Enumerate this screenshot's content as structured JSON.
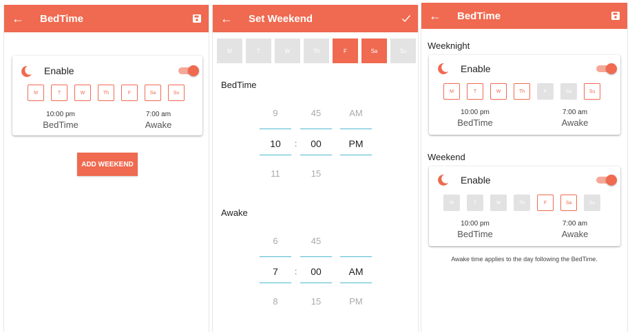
{
  "colors": {
    "accent": "#ef6a50",
    "toggle_track": "#f5a898",
    "picker_line": "#4cb8d0",
    "inactive": "#e2e2e2"
  },
  "screen1": {
    "title": "BedTime",
    "card": {
      "enable_label": "Enable",
      "days": [
        "M",
        "T",
        "W",
        "Th",
        "F",
        "Sa",
        "Su"
      ],
      "bedtime_time": "10:00 pm",
      "bedtime_label": "BedTime",
      "awake_time": "7:00 am",
      "awake_label": "Awake"
    },
    "add_weekend_label": "ADD WEEKEND"
  },
  "screen2": {
    "title": "Set Weekend",
    "days": [
      {
        "label": "M",
        "selected": false
      },
      {
        "label": "T",
        "selected": false
      },
      {
        "label": "W",
        "selected": false
      },
      {
        "label": "Th",
        "selected": false
      },
      {
        "label": "F",
        "selected": true
      },
      {
        "label": "Sa",
        "selected": true
      },
      {
        "label": "Su",
        "selected": false
      }
    ],
    "bedtime_label": "BedTime",
    "bedtime_picker": {
      "hours": [
        "9",
        "10",
        "11"
      ],
      "minutes": [
        "45",
        "00",
        "15"
      ],
      "ampm": [
        "AM",
        "PM",
        ""
      ]
    },
    "awake_label": "Awake",
    "awake_picker": {
      "hours": [
        "6",
        "7",
        "8"
      ],
      "minutes": [
        "45",
        "00",
        "15"
      ],
      "ampm": [
        "",
        "AM",
        "PM"
      ]
    },
    "separator": ":"
  },
  "screen3": {
    "title": "BedTime",
    "weeknight": {
      "section_label": "Weeknight",
      "enable_label": "Enable",
      "days": [
        {
          "label": "M",
          "on": true
        },
        {
          "label": "T",
          "on": true
        },
        {
          "label": "W",
          "on": true
        },
        {
          "label": "Th",
          "on": true
        },
        {
          "label": "F",
          "on": false
        },
        {
          "label": "Sa",
          "on": false
        },
        {
          "label": "Su",
          "on": true
        }
      ],
      "bedtime_time": "10:00 pm",
      "bedtime_label": "BedTime",
      "awake_time": "7:00 am",
      "awake_label": "Awake"
    },
    "weekend": {
      "section_label": "Weekend",
      "enable_label": "Enable",
      "days": [
        {
          "label": "M",
          "on": false
        },
        {
          "label": "T",
          "on": false
        },
        {
          "label": "W",
          "on": false
        },
        {
          "label": "Th",
          "on": false
        },
        {
          "label": "F",
          "on": true
        },
        {
          "label": "Sa",
          "on": true
        },
        {
          "label": "Su",
          "on": false
        }
      ],
      "bedtime_time": "10:00 pm",
      "bedtime_label": "BedTime",
      "awake_time": "7:00 am",
      "awake_label": "Awake"
    },
    "note": "Awake time applies to the day following the BedTime."
  }
}
